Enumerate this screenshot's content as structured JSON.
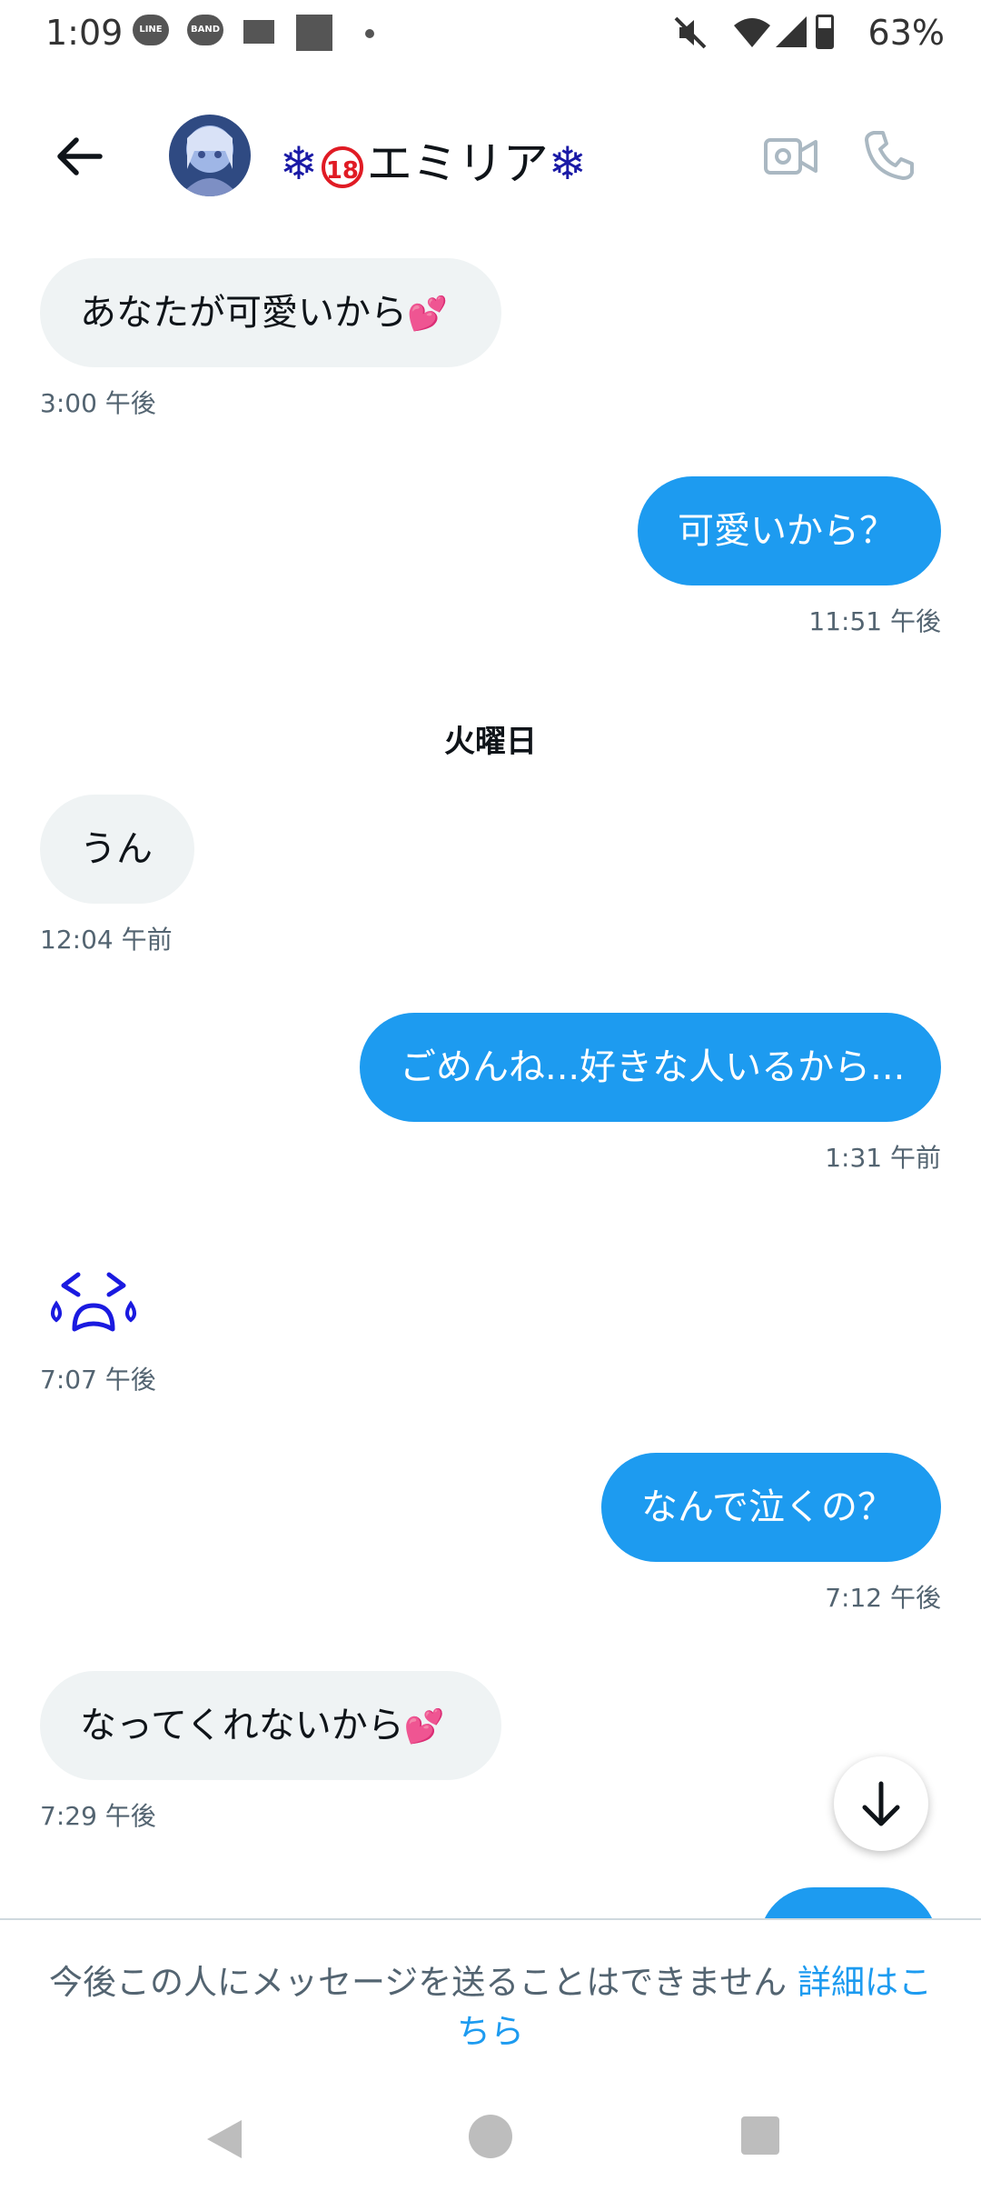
{
  "status_bar": {
    "time": "1:09",
    "notif_icons": [
      "LINE",
      "BAND"
    ],
    "battery": "63%",
    "battery_level": 0.63
  },
  "header": {
    "title_text": "エミリア",
    "snow_left": "❄",
    "badge": "18",
    "snow_right": "❄"
  },
  "messages": [
    {
      "text": "あなたが可愛いから",
      "heart": "💕",
      "time": "3:00 午後"
    },
    {
      "text": "可愛いから？",
      "time": "11:51 午後"
    },
    {
      "day": "火曜日"
    },
    {
      "text": "うん",
      "time": "12:04 午前"
    },
    {
      "text": "ごめんね...好きな人いるから...",
      "time": "1:31 午前"
    },
    {
      "emoji": "crying-face",
      "time": "7:07 午後"
    },
    {
      "text": "なんで泣くの？",
      "time": "7:12 午後"
    },
    {
      "text": "なってくれないから",
      "heart": "💕",
      "time": "7:29 午後"
    }
  ],
  "notice": {
    "text": "今後この人にメッセージを送ることはできません ",
    "link": "詳細はこちら"
  },
  "colors": {
    "accent": "#1d9bf0",
    "incoming_bubble": "#eff3f4",
    "secondary_text": "#536471"
  }
}
